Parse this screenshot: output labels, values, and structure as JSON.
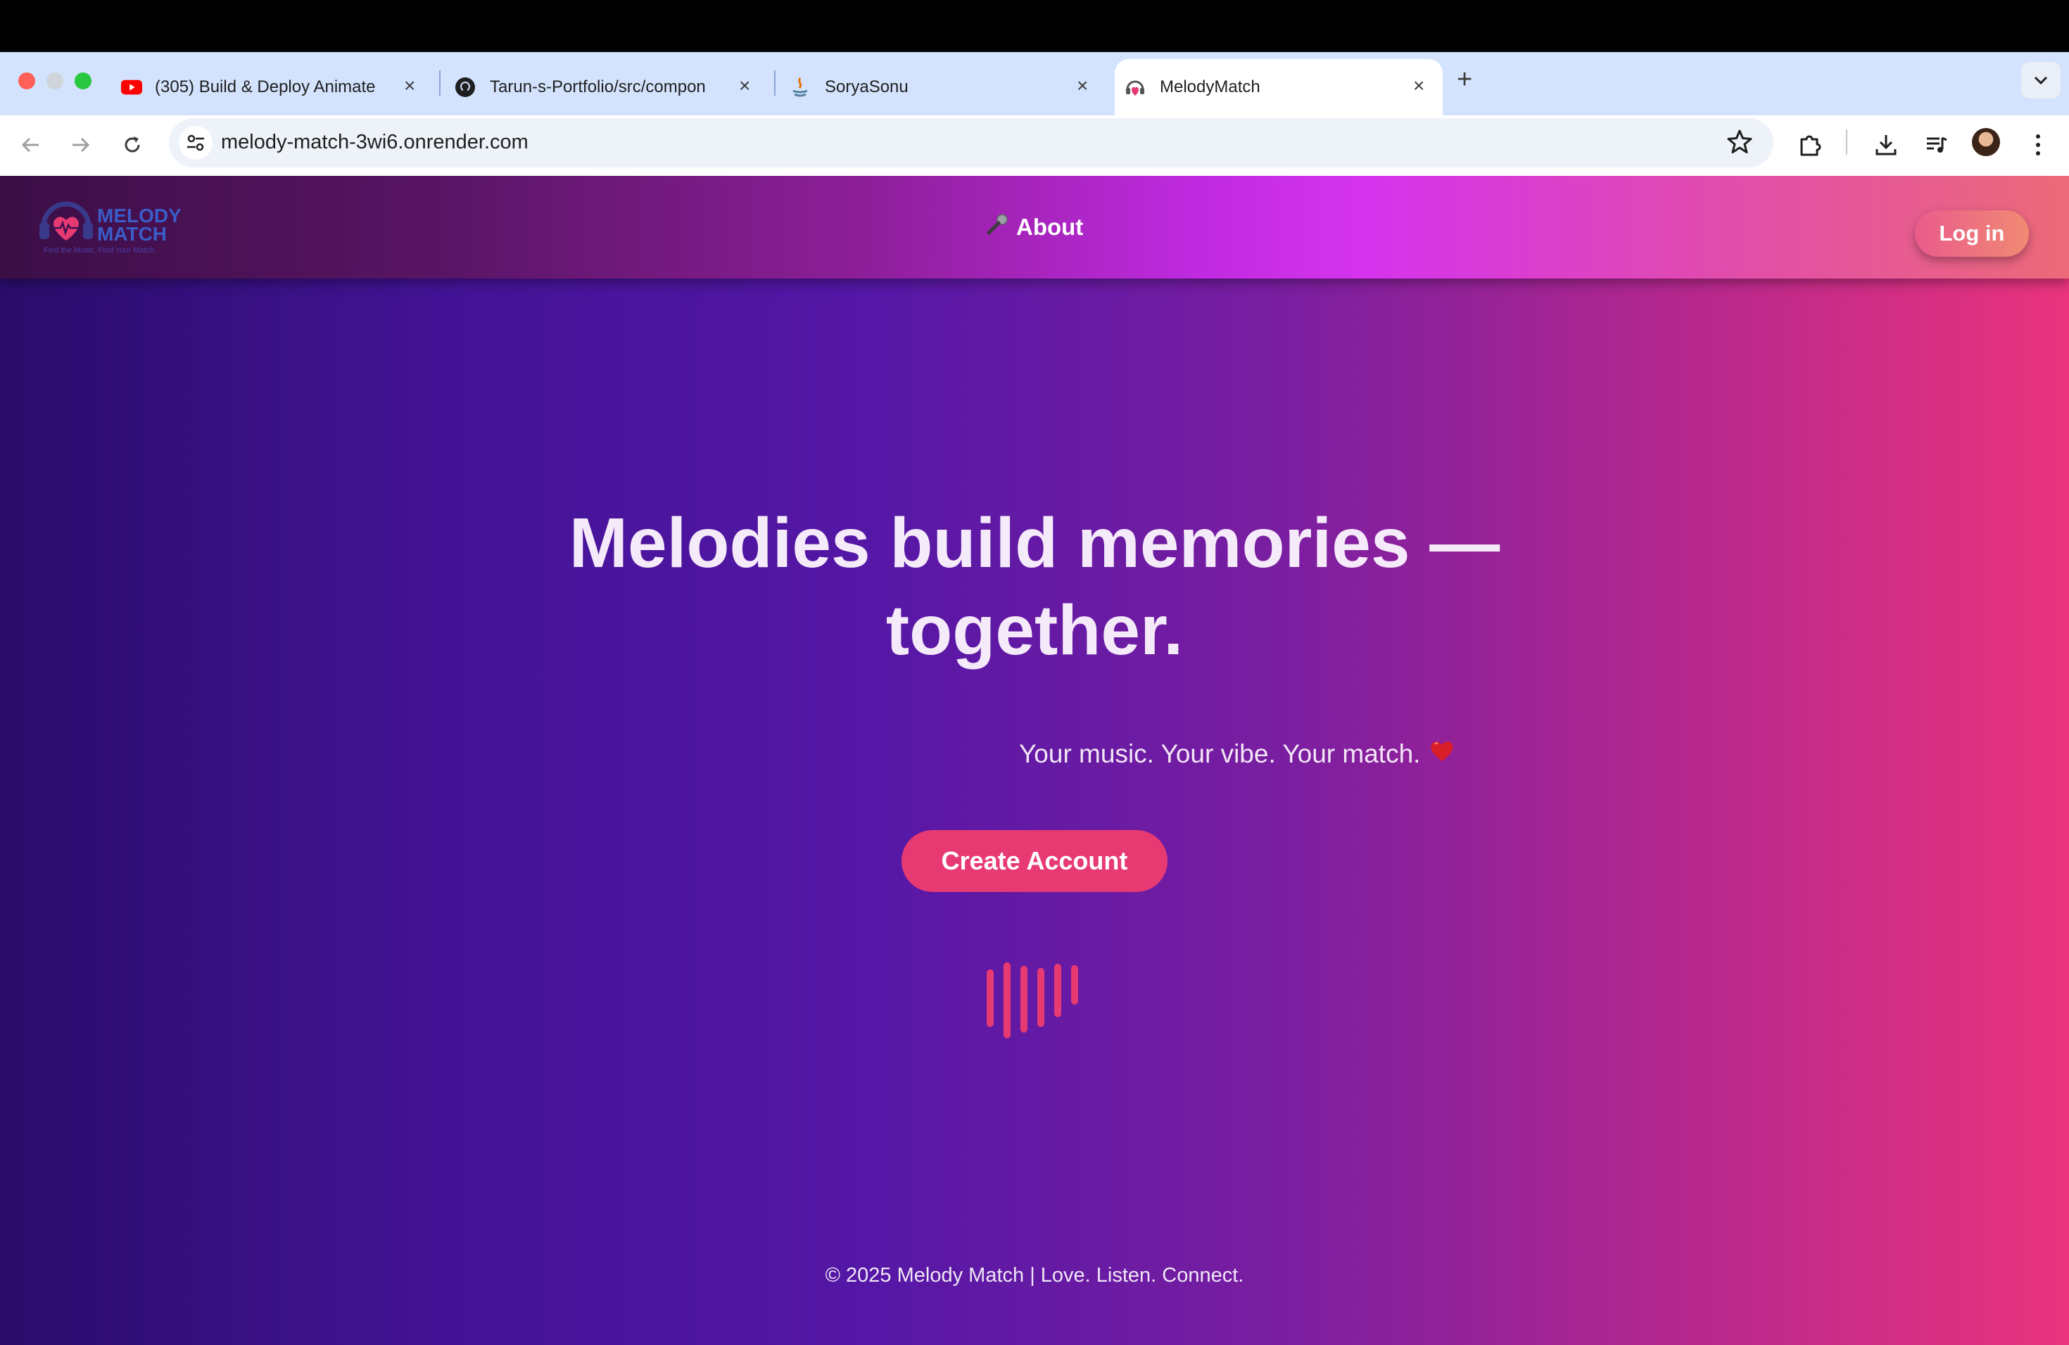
{
  "browser": {
    "tabs": [
      {
        "title": "(305) Build & Deploy Animate",
        "favicon": "youtube-icon"
      },
      {
        "title": "Tarun-s-Portfolio/src/compon",
        "favicon": "github-icon"
      },
      {
        "title": "SoryaSonu",
        "favicon": "java-icon"
      },
      {
        "title": "MelodyMatch",
        "favicon": "melodymatch-icon",
        "active": true
      }
    ],
    "url": "melody-match-3wi6.onrender.com"
  },
  "header": {
    "logo": {
      "line1": "MELODY",
      "line2": "MATCH",
      "tagline": "Find the Music. Find Your Match."
    },
    "about_label": "About",
    "about_icon": "microphone-icon",
    "login_label": "Log in"
  },
  "hero": {
    "title_line1": "Melodies build memories —",
    "title_line2": "together.",
    "tagline": "Your music. Your vibe. Your match.",
    "tagline_icon": "heart-icon",
    "cta_label": "Create Account"
  },
  "footer": {
    "text": "© 2025 Melody Match | Love. Listen. Connect."
  },
  "colors": {
    "accent": "#e73a72",
    "header_start": "#3b0e45",
    "header_end": "#ec6a78"
  }
}
